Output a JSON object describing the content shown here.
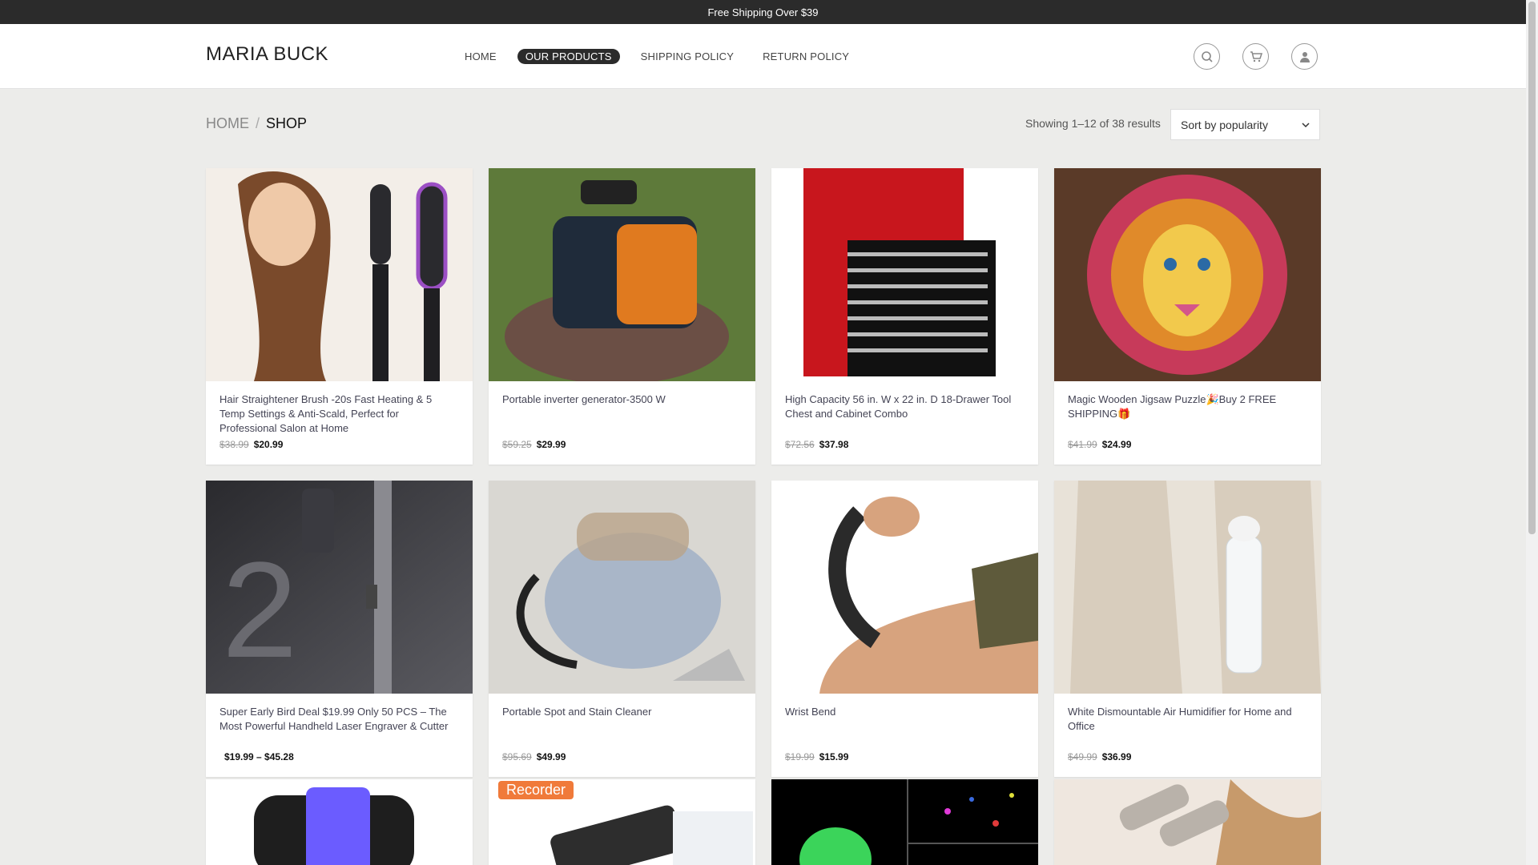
{
  "topbar": {
    "text": "Free Shipping Over $39"
  },
  "header": {
    "logo": "MARIA BUCK",
    "nav": [
      {
        "label": "HOME",
        "active": false
      },
      {
        "label": "OUR PRODUCTS",
        "active": true
      },
      {
        "label": "SHIPPING POLICY",
        "active": false
      },
      {
        "label": "RETURN POLICY",
        "active": false
      }
    ]
  },
  "breadcrumb": {
    "home": "HOME",
    "separator": "/",
    "current": "SHOP"
  },
  "results": "Showing 1–12 of 38 results",
  "sort": {
    "selected": "Sort by popularity"
  },
  "products": [
    {
      "title": "Hair Straightener Brush -20s Fast Heating & 5 Temp Settings & Anti-Scald, Perfect for Professional Salon at Home",
      "old_price": "$38.99",
      "price": "$20.99"
    },
    {
      "title": "Portable inverter generator-3500 W",
      "old_price": "$59.25",
      "price": "$29.99"
    },
    {
      "title": "High Capacity 56 in. W x 22 in. D 18-Drawer Tool Chest and Cabinet Combo",
      "old_price": "$72.56",
      "price": "$37.98"
    },
    {
      "title": "Magic Wooden Jigsaw Puzzle🎉Buy 2 FREE SHIPPING🎁",
      "old_price": "$41.99",
      "price": "$24.99"
    },
    {
      "title": "Super Early Bird Deal $19.99 Only 50 PCS – The Most Powerful Handheld Laser Engraver & Cutter",
      "old_price": "",
      "price": "$19.99 – $45.28"
    },
    {
      "title": "Portable Spot and Stain Cleaner",
      "old_price": "$95.69",
      "price": "$49.99"
    },
    {
      "title": "Wrist Bend",
      "old_price": "$19.99",
      "price": "$15.99"
    },
    {
      "title": "White Dismountable Air Humidifier for Home and Office",
      "old_price": "$49.99",
      "price": "$36.99"
    }
  ],
  "third_row_badge": "Recorder",
  "colors": {
    "topbar": "#2b2b2b",
    "page_bg": "#ececea",
    "accent": "#2b2b2b"
  }
}
